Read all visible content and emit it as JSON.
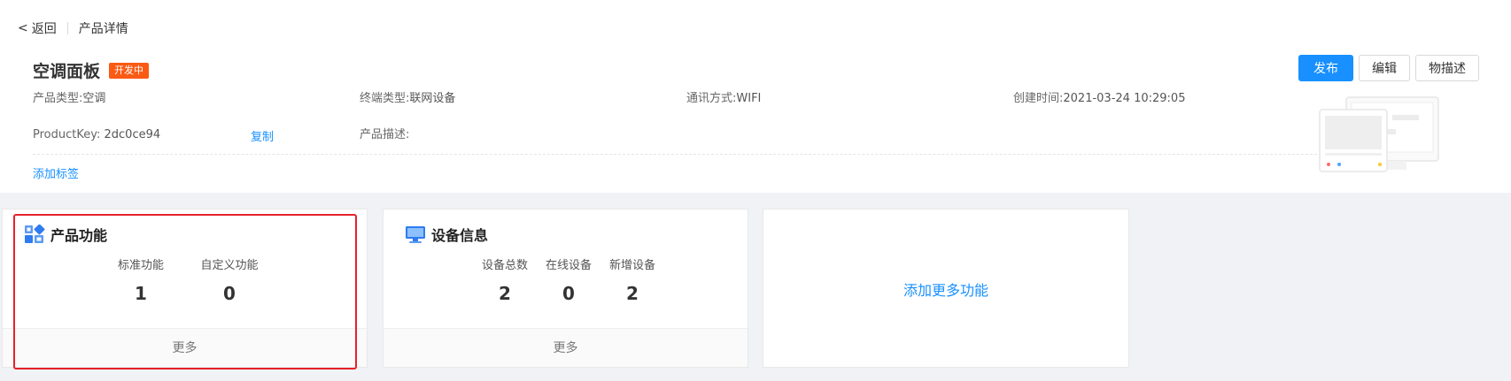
{
  "breadcrumb": {
    "back_label": "返回",
    "current": "产品详情"
  },
  "product": {
    "name": "空调面板",
    "status": "开发中"
  },
  "actions": {
    "publish": "发布",
    "edit": "编辑",
    "describe": "物描述"
  },
  "info": {
    "product_type": {
      "label": "产品类型:",
      "value": "空调"
    },
    "terminal_type": {
      "label": "终端类型:",
      "value": "联网设备"
    },
    "comm_mode": {
      "label": "通讯方式:",
      "value": "WIFI"
    },
    "created_at": {
      "label": "创建时间:",
      "value": "2021-03-24 10:29:05"
    },
    "product_key": {
      "label": "ProductKey:",
      "value": "2dc0ce94"
    },
    "copy_label": "复制",
    "description": {
      "label": "产品描述:",
      "value": ""
    },
    "add_tag": "添加标签"
  },
  "cards": {
    "product_functions": {
      "title": "产品功能",
      "stats": [
        {
          "label": "标准功能",
          "value": "1"
        },
        {
          "label": "自定义功能",
          "value": "0"
        }
      ],
      "more": "更多"
    },
    "device_info": {
      "title": "设备信息",
      "stats": [
        {
          "label": "设备总数",
          "value": "2"
        },
        {
          "label": "在线设备",
          "value": "0"
        },
        {
          "label": "新增设备",
          "value": "2"
        }
      ],
      "more": "更多"
    },
    "add_more": {
      "label": "添加更多功能"
    }
  },
  "colors": {
    "accent": "#1890ff",
    "status_badge": "#fa5a14",
    "highlight": "#e5222a",
    "background": "#f0f2f5"
  },
  "icons": [
    "chevron-left-icon",
    "function-blocks-icon",
    "monitor-icon",
    "product-illustration"
  ]
}
